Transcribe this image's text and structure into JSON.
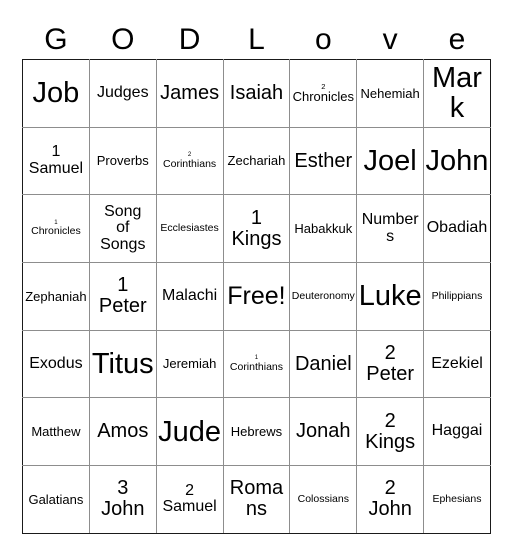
{
  "card": {
    "title_letters": [
      "G",
      "O",
      "D",
      "L",
      "o",
      "v",
      "e"
    ],
    "free_space_label": "Free!",
    "columns": 7,
    "rows": 7,
    "border_color": "#1a1a1a",
    "grid_line_color": "#8d8d8d",
    "background_color": "#ffffff",
    "text_color": "#000000",
    "cells": [
      [
        {
          "text": "Job",
          "lines": [
            "Job"
          ],
          "size": "xxl"
        },
        {
          "text": "Judges",
          "lines": [
            "Judges"
          ],
          "size": "m"
        },
        {
          "text": "James",
          "lines": [
            "James"
          ],
          "size": "l"
        },
        {
          "text": "Isaiah",
          "lines": [
            "Isaiah"
          ],
          "size": "l"
        },
        {
          "text": "2 Chronicles",
          "lines": [
            "2",
            "Chronicles"
          ],
          "size": "s",
          "numbered": true
        },
        {
          "text": "Nehemiah",
          "lines": [
            "Nehemiah"
          ],
          "size": "s"
        },
        {
          "text": "Mark",
          "lines": [
            "Mark"
          ],
          "size": "xxl"
        }
      ],
      [
        {
          "text": "1 Samuel",
          "lines": [
            "1",
            "Samuel"
          ],
          "size": "m"
        },
        {
          "text": "Proverbs",
          "lines": [
            "Proverbs"
          ],
          "size": "s"
        },
        {
          "text": "2 Corinthians",
          "lines": [
            "2",
            "Corinthians"
          ],
          "size": "xs",
          "numbered": true
        },
        {
          "text": "Zechariah",
          "lines": [
            "Zechariah"
          ],
          "size": "s"
        },
        {
          "text": "Esther",
          "lines": [
            "Esther"
          ],
          "size": "l"
        },
        {
          "text": "Joel",
          "lines": [
            "Joel"
          ],
          "size": "xxl"
        },
        {
          "text": "John",
          "lines": [
            "John"
          ],
          "size": "xxl"
        }
      ],
      [
        {
          "text": "1 Chronicles",
          "lines": [
            "1",
            "Chronicles"
          ],
          "size": "xs",
          "numbered": true
        },
        {
          "text": "Song of Songs",
          "lines": [
            "Song",
            "of",
            "Songs"
          ],
          "size": "m"
        },
        {
          "text": "Ecclesiastes",
          "lines": [
            "Ecclesiastes"
          ],
          "size": "xs"
        },
        {
          "text": "1 Kings",
          "lines": [
            "1",
            "Kings"
          ],
          "size": "l"
        },
        {
          "text": "Habakkuk",
          "lines": [
            "Habakkuk"
          ],
          "size": "s"
        },
        {
          "text": "Numbers",
          "lines": [
            "Numbers"
          ],
          "size": "m"
        },
        {
          "text": "Obadiah",
          "lines": [
            "Obadiah"
          ],
          "size": "m"
        }
      ],
      [
        {
          "text": "Zephaniah",
          "lines": [
            "Zephaniah"
          ],
          "size": "s"
        },
        {
          "text": "1 Peter",
          "lines": [
            "1",
            "Peter"
          ],
          "size": "l"
        },
        {
          "text": "Malachi",
          "lines": [
            "Malachi"
          ],
          "size": "m"
        },
        {
          "text": "Free!",
          "lines": [
            "Free!"
          ],
          "size": "xl",
          "free": true
        },
        {
          "text": "Deuteronomy",
          "lines": [
            "Deuteronomy"
          ],
          "size": "xs"
        },
        {
          "text": "Luke",
          "lines": [
            "Luke"
          ],
          "size": "xxl"
        },
        {
          "text": "Philippians",
          "lines": [
            "Philippians"
          ],
          "size": "xs"
        }
      ],
      [
        {
          "text": "Exodus",
          "lines": [
            "Exodus"
          ],
          "size": "m"
        },
        {
          "text": "Titus",
          "lines": [
            "Titus"
          ],
          "size": "xxl"
        },
        {
          "text": "Jeremiah",
          "lines": [
            "Jeremiah"
          ],
          "size": "s"
        },
        {
          "text": "1 Corinthians",
          "lines": [
            "1",
            "Corinthians"
          ],
          "size": "xs",
          "numbered": true
        },
        {
          "text": "Daniel",
          "lines": [
            "Daniel"
          ],
          "size": "l"
        },
        {
          "text": "2 Peter",
          "lines": [
            "2",
            "Peter"
          ],
          "size": "l"
        },
        {
          "text": "Ezekiel",
          "lines": [
            "Ezekiel"
          ],
          "size": "m"
        }
      ],
      [
        {
          "text": "Matthew",
          "lines": [
            "Matthew"
          ],
          "size": "s"
        },
        {
          "text": "Amos",
          "lines": [
            "Amos"
          ],
          "size": "l"
        },
        {
          "text": "Jude",
          "lines": [
            "Jude"
          ],
          "size": "xxl"
        },
        {
          "text": "Hebrews",
          "lines": [
            "Hebrews"
          ],
          "size": "s"
        },
        {
          "text": "Jonah",
          "lines": [
            "Jonah"
          ],
          "size": "l"
        },
        {
          "text": "2 Kings",
          "lines": [
            "2",
            "Kings"
          ],
          "size": "l"
        },
        {
          "text": "Haggai",
          "lines": [
            "Haggai"
          ],
          "size": "m"
        }
      ],
      [
        {
          "text": "Galatians",
          "lines": [
            "Galatians"
          ],
          "size": "s"
        },
        {
          "text": "3 John",
          "lines": [
            "3",
            "John"
          ],
          "size": "l"
        },
        {
          "text": "2 Samuel",
          "lines": [
            "2",
            "Samuel"
          ],
          "size": "m"
        },
        {
          "text": "Romans",
          "lines": [
            "Romans"
          ],
          "size": "l"
        },
        {
          "text": "Colossians",
          "lines": [
            "Colossians"
          ],
          "size": "xs"
        },
        {
          "text": "2 John",
          "lines": [
            "2",
            "John"
          ],
          "size": "l"
        },
        {
          "text": "Ephesians",
          "lines": [
            "Ephesians"
          ],
          "size": "xs"
        }
      ]
    ]
  }
}
